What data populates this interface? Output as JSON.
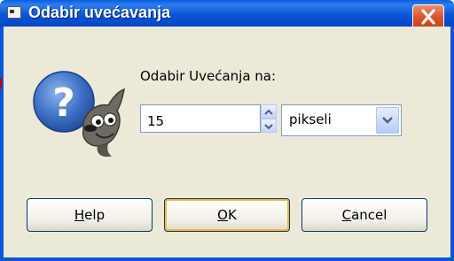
{
  "window": {
    "title": "Odabir uvećavanja"
  },
  "form": {
    "prompt": "Odabir Uvećanja na:",
    "value": "15",
    "unit": "pikseli"
  },
  "buttons": {
    "help_accel": "H",
    "help_rest": "elp",
    "ok_accel": "O",
    "ok_rest": "K",
    "cancel_accel": "C",
    "cancel_rest": "ancel"
  },
  "icons": {
    "window": "app-window-icon",
    "close": "close-icon",
    "dialog": "question-mascot-icon",
    "spin_up": "arrow-up-icon",
    "spin_down": "arrow-down-icon",
    "dropdown": "chevron-down-icon"
  },
  "colors": {
    "titlebar": "#0a56d8",
    "dialog_bg": "#ece9d8",
    "close_button": "#d9532c",
    "default_button_focus": "#f8b43c"
  }
}
